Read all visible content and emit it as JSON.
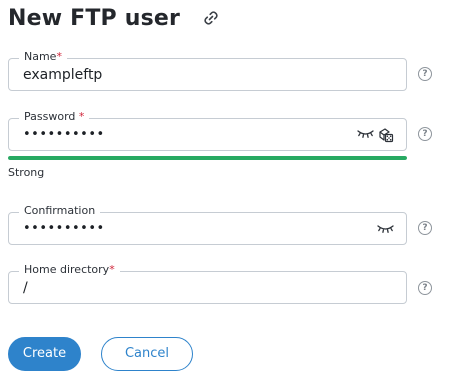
{
  "header": {
    "title": "New FTP user",
    "link_icon": "link-icon"
  },
  "form": {
    "name": {
      "label": "Name",
      "required_mark": "*",
      "value": "exampleftp"
    },
    "password": {
      "label": "Password",
      "required_mark": "*",
      "value": "••••••••••",
      "strength_label": "Strong",
      "strength_level": 1.0,
      "strength_color": "#27a962"
    },
    "confirmation": {
      "label": "Confirmation",
      "value": "••••••••••"
    },
    "home_directory": {
      "label": "Home directory",
      "required_mark": "*",
      "value": "/"
    },
    "help_glyph": "?"
  },
  "actions": {
    "create_label": "Create",
    "cancel_label": "Cancel",
    "accent_color": "#2e83cb"
  }
}
